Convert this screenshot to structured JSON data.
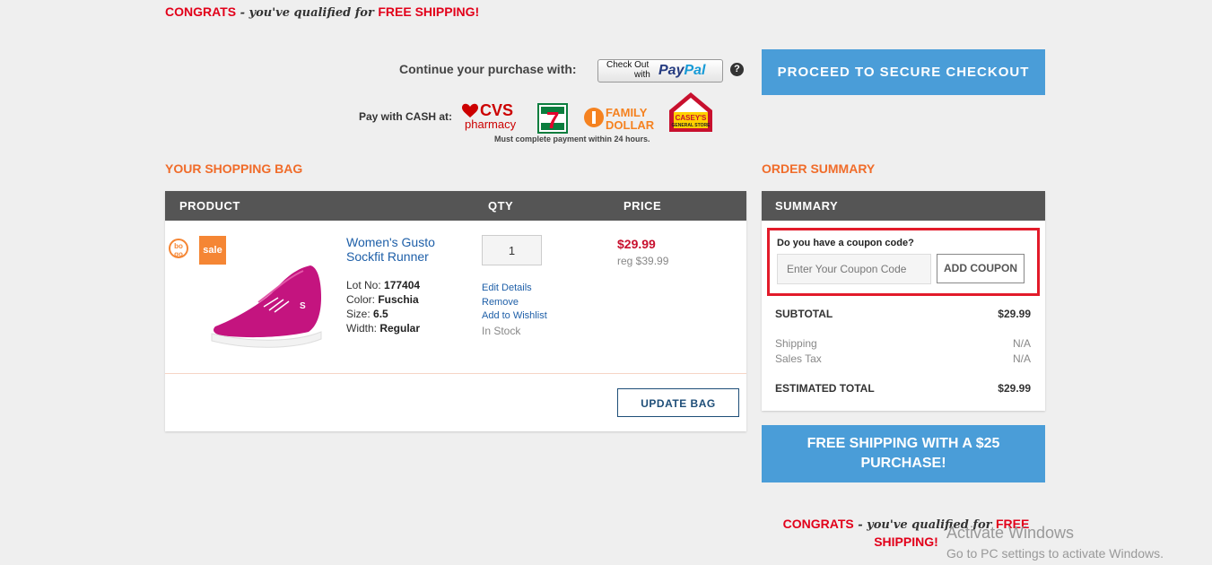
{
  "promo": {
    "congrats": "CONGRATS",
    "middle": " - you've qualified for ",
    "free_shipping": "FREE SHIPPING!"
  },
  "payment": {
    "continue_label": "Continue your purchase with:",
    "paypal_line1": "Check Out",
    "paypal_line2": "with",
    "paypal_logo_a": "Pay",
    "paypal_logo_b": "Pal",
    "help": "?",
    "cash_label": "Pay with CASH at:",
    "cash_note": "Must complete payment within 24 hours.",
    "stores": [
      "CVS pharmacy",
      "7-Eleven",
      "Family Dollar",
      "Casey's General Store"
    ]
  },
  "checkout_button": "PROCEED TO SECURE CHECKOUT",
  "bag": {
    "title": "YOUR SHOPPING BAG",
    "headers": {
      "product": "PRODUCT",
      "qty": "QTY",
      "price": "PRICE"
    },
    "item": {
      "bogo_a": "bo",
      "bogo_b": "go",
      "sale": "sale",
      "name": "Women's Gusto Sockfit Runner",
      "lot_label": "Lot No: ",
      "lot": "177404",
      "color_label": "Color: ",
      "color": "Fuschia",
      "size_label": "Size: ",
      "size": "6.5",
      "width_label": "Width: ",
      "width": "Regular",
      "qty": "1",
      "edit": "Edit Details",
      "remove": "Remove",
      "wishlist": "Add to Wishlist",
      "stock": "In Stock",
      "price": "$29.99",
      "reg": "reg $39.99"
    },
    "update_button": "UPDATE BAG"
  },
  "summary": {
    "title": "ORDER SUMMARY",
    "header": "SUMMARY",
    "coupon_question": "Do you have a coupon code?",
    "coupon_placeholder": "Enter Your Coupon Code",
    "add_coupon": "ADD COUPON",
    "subtotal_label": "SUBTOTAL",
    "subtotal": "$29.99",
    "shipping_label": "Shipping",
    "shipping": "N/A",
    "tax_label": "Sales Tax",
    "tax": "N/A",
    "total_label": "ESTIMATED TOTAL",
    "total": "$29.99"
  },
  "free_shipping_banner_1": "FREE SHIPPING WITH A $25",
  "free_shipping_banner_2": "PURCHASE!",
  "watermark": {
    "line1": "Activate Windows",
    "line2": "Go to PC settings to activate Windows."
  },
  "colors": {
    "accent_orange": "#f06c2a",
    "button_blue": "#4a9dd8",
    "price_red": "#c8102e",
    "highlight_red": "#e21b2a"
  }
}
